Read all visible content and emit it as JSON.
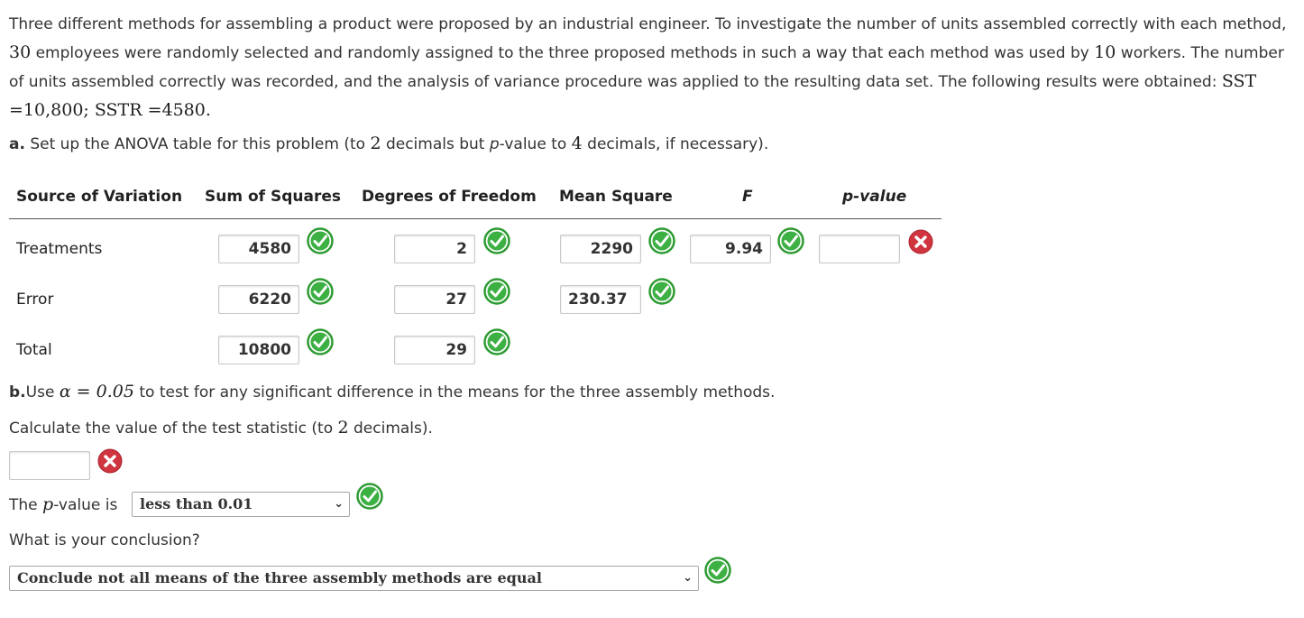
{
  "problem": {
    "p1": "Three different methods for assembling a product were proposed by an industrial engineer. To investigate the number of units assembled correctly with each method, ",
    "n_employees": "30",
    "p2": " employees were randomly selected and randomly assigned to the three proposed methods in such a way that each method was used by ",
    "n_workers": "10",
    "p3": " workers. The number of units assembled correctly was recorded, and the analysis of variance procedure was applied to the resulting data set. The following results were obtained: ",
    "sst": "SST =10,800",
    "sep": "; ",
    "sstr": "SSTR =4580."
  },
  "part_a": {
    "label": "a.",
    "t1": " Set up the ANOVA table for this problem (to ",
    "d1": "2",
    "t2": " decimals but ",
    "pvar": "p",
    "t3": "-value to ",
    "d2": "4",
    "t4": " decimals, if necessary)."
  },
  "table": {
    "headers": {
      "source": "Source of Variation",
      "ss": "Sum of Squares",
      "df": "Degrees of Freedom",
      "ms": "Mean Square",
      "f": "F",
      "p": "p-value"
    },
    "rows": {
      "treatments": {
        "label": "Treatments",
        "ss": "4580",
        "df": "2",
        "ms": "2290",
        "f": "9.94",
        "p": ""
      },
      "error": {
        "label": "Error",
        "ss": "6220",
        "df": "27",
        "ms": "230.37"
      },
      "total": {
        "label": "Total",
        "ss": "10800",
        "df": "29"
      }
    }
  },
  "part_b": {
    "label": "b.",
    "t1": "Use ",
    "alpha": "α = 0.05",
    "t2": " to test for any significant difference in the means for the three assembly methods.",
    "calc1": "Calculate the value of the test statistic (to ",
    "calc_d": "2",
    "calc2": " decimals).",
    "test_stat_value": "",
    "pvalue_prefix": "The ",
    "pvalue_var": "p",
    "pvalue_suffix": "-value is",
    "pvalue_selected": "less than 0.01",
    "conclusion_q": "What is your conclusion?",
    "conclusion_selected": "Conclude not all means of the three assembly methods are equal"
  },
  "colors": {
    "correct": "#2e9b33",
    "incorrect": "#d0343f"
  },
  "icons": {
    "correct": "check-circle-icon",
    "incorrect": "x-circle-icon",
    "dropdown": "chevron-down-icon"
  }
}
